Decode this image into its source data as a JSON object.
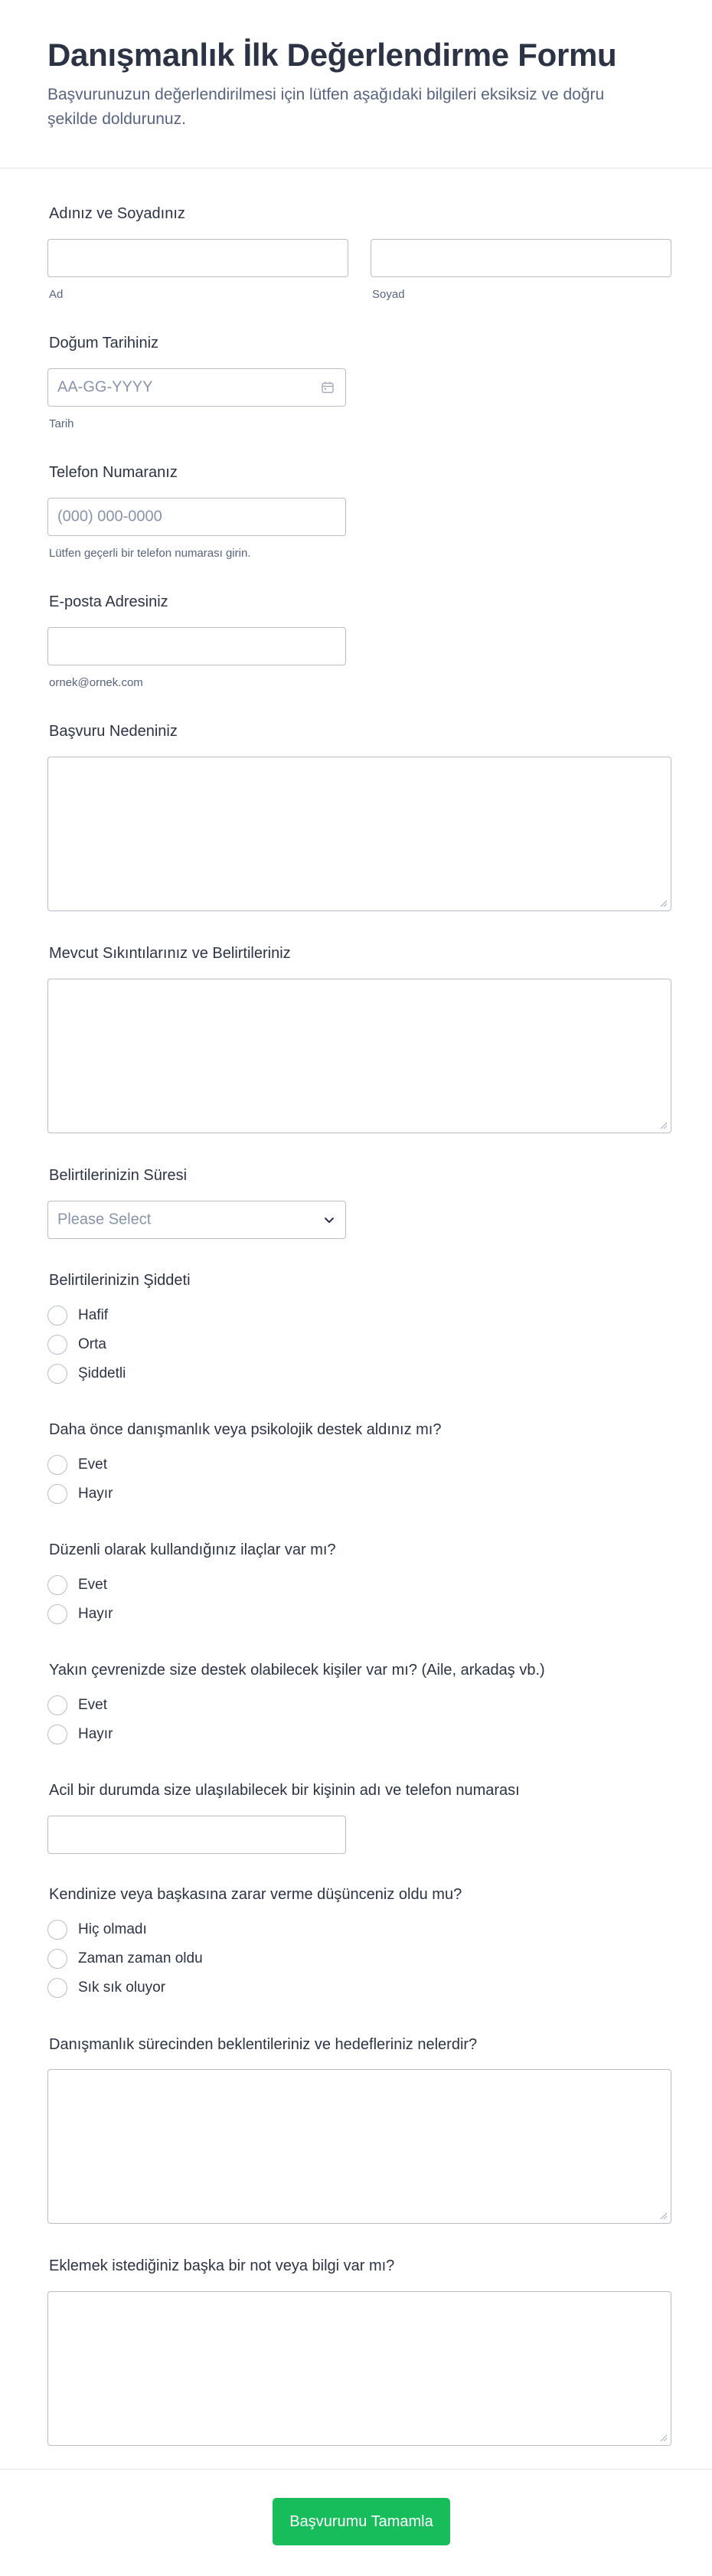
{
  "header": {
    "title": "Danışmanlık İlk Değerlendirme Formu",
    "subtitle": "Başvurunuzun değerlendirilmesi için lütfen aşağıdaki bilgileri eksiksiz ve doğru şekilde doldurunuz."
  },
  "name": {
    "label": "Adınız ve Soyadınız",
    "first_sublabel": "Ad",
    "last_sublabel": "Soyad",
    "first_value": "",
    "last_value": ""
  },
  "birth": {
    "label": "Doğum Tarihiniz",
    "placeholder": "AA-GG-YYYY",
    "sublabel": "Tarih",
    "icon": "calendar-icon"
  },
  "phone": {
    "label": "Telefon Numaranız",
    "placeholder": "(000) 000-0000",
    "sublabel": "Lütfen geçerli bir telefon numarası girin."
  },
  "email": {
    "label": "E-posta Adresiniz",
    "value": "",
    "sublabel": "ornek@ornek.com"
  },
  "reason": {
    "label": "Başvuru Nedeniniz",
    "value": ""
  },
  "symptoms": {
    "label": "Mevcut Sıkıntılarınız ve Belirtileriniz",
    "value": ""
  },
  "duration": {
    "label": "Belirtilerinizin Süresi",
    "selected": "Please Select",
    "icon": "chevron-down-icon"
  },
  "severity": {
    "label": "Belirtilerinizin Şiddeti",
    "options": [
      "Hafif",
      "Orta",
      "Şiddetli"
    ]
  },
  "prior_support": {
    "label": "Daha önce danışmanlık veya psikolojik destek aldınız mı?",
    "options": [
      "Evet",
      "Hayır"
    ]
  },
  "medication": {
    "label": "Düzenli olarak kullandığınız ilaçlar var mı?",
    "options": [
      "Evet",
      "Hayır"
    ]
  },
  "support_network": {
    "label": "Yakın çevrenizde size destek olabilecek kişiler var mı? (Aile, arkadaş vb.)",
    "options": [
      "Evet",
      "Hayır"
    ]
  },
  "emergency": {
    "label": "Acil bir durumda size ulaşılabilecek bir kişinin adı ve telefon numarası",
    "value": ""
  },
  "self_harm": {
    "label": "Kendinize veya başkasına zarar verme düşünceniz oldu mu?",
    "options": [
      "Hiç olmadı",
      "Zaman zaman oldu",
      "Sık sık oluyor"
    ]
  },
  "expectations": {
    "label": "Danışmanlık sürecinden beklentileriniz ve hedefleriniz nelerdir?",
    "value": ""
  },
  "notes": {
    "label": "Eklemek istediğiniz başka bir not veya bilgi var mı?",
    "value": ""
  },
  "submit": {
    "label": "Başvurumu Tamamla",
    "color": "#18bd5b"
  },
  "colors": {
    "text": "#2c3345",
    "muted": "#57647e",
    "border": "#b8bdc9",
    "accent": "#18bd5b"
  }
}
